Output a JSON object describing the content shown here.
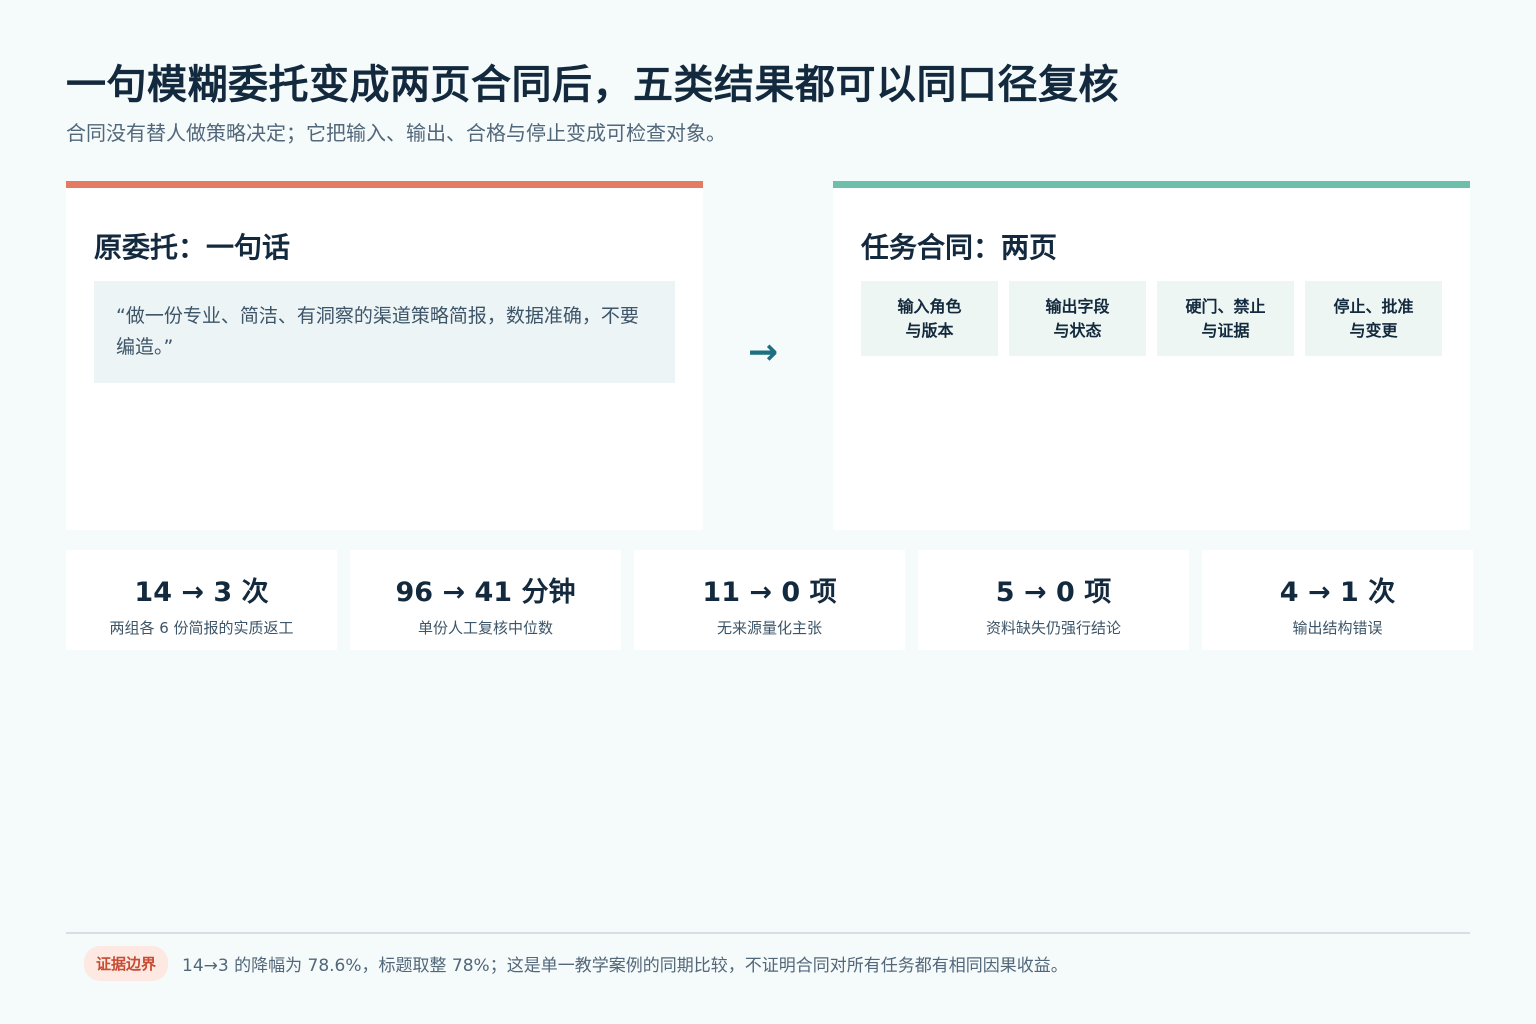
{
  "header": {
    "title": "一句模糊委托变成两页合同后，五类结果都可以同口径复核",
    "subtitle": "合同没有替人做策略决定；它把输入、输出、合格与停止变成可检查对象。"
  },
  "left_card": {
    "heading": "原委托：一句话",
    "quote": "“做一份专业、简洁、有洞察的渠道策略简报，数据准确，不要编造。”"
  },
  "arrow": "→",
  "right_card": {
    "heading": "任务合同：两页",
    "chips": [
      {
        "line1": "输入角色",
        "line2": "与版本"
      },
      {
        "line1": "输出字段",
        "line2": "与状态"
      },
      {
        "line1": "硬门、禁止",
        "line2": "与证据"
      },
      {
        "line1": "停止、批准",
        "line2": "与变更"
      }
    ]
  },
  "metrics": [
    {
      "value": "14 → 3 次",
      "label": "两组各 6 份简报的实质返工"
    },
    {
      "value": "96 → 41 分钟",
      "label": "单份人工复核中位数"
    },
    {
      "value": "11 → 0 项",
      "label": "无来源量化主张"
    },
    {
      "value": "5 → 0 项",
      "label": "资料缺失仍强行结论"
    },
    {
      "value": "4 → 1 次",
      "label": "输出结构错误"
    }
  ],
  "footer": {
    "badge": "证据边界",
    "note": "14→3 的降幅为 78.6%，标题取整 78%；这是单一教学案例的同期比较，不证明合同对所有任务都有相同因果收益。"
  },
  "colors": {
    "left_accent": "#e57a62",
    "right_accent": "#6cbfaa",
    "arrow": "#1f6f82",
    "badge_text": "#c84b32"
  }
}
